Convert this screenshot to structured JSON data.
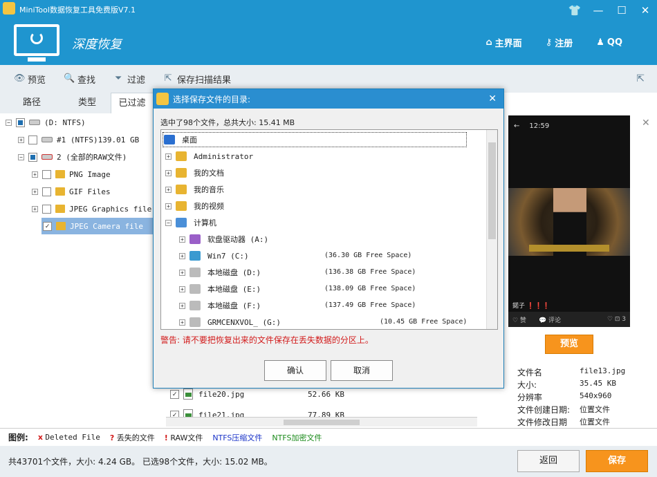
{
  "window": {
    "title": "MiniTool数据恢复工具免费版V7.1",
    "app_name": "深度恢复"
  },
  "header_nav": [
    {
      "label": "主界面",
      "icon": "home-icon"
    },
    {
      "label": "注册",
      "icon": "key-icon"
    },
    {
      "label": "QQ",
      "icon": "qq-icon"
    }
  ],
  "toolbar": {
    "preview": "预览",
    "find": "查找",
    "filter": "过滤",
    "save_scan": "保存扫描结果"
  },
  "tabs": [
    "路径",
    "类型",
    "已过滤"
  ],
  "tree": [
    {
      "label": "(D: NTFS)"
    },
    {
      "label": "#1 (NTFS)139.01 GB"
    },
    {
      "label": "2 (全部的RAW文件)"
    },
    {
      "label": "PNG Image"
    },
    {
      "label": "GIF Files"
    },
    {
      "label": "JPEG Graphics file"
    },
    {
      "label": "JPEG Camera file"
    }
  ],
  "preview_panel": {
    "phone_time": "12:59",
    "phone_caption": "鍩子 ❗❗❗",
    "phone_footer": [
      "♡ 赞",
      "💬 评论",
      "♡ ⊡ 3"
    ],
    "preview_button": "预览",
    "info": [
      {
        "k": "文件名",
        "v": "file13.jpg"
      },
      {
        "k": "大小:",
        "v": "35.45 KB"
      },
      {
        "k": "分辨率",
        "v": "540x960"
      },
      {
        "k": "文件创建日期:",
        "v": "位置文件"
      },
      {
        "k": "文件修改日期",
        "v": "位置文件"
      }
    ]
  },
  "file_list": [
    {
      "name": "file20.jpg",
      "size": "52.66 KB"
    },
    {
      "name": "file21.jpg",
      "size": "77.89 KB"
    }
  ],
  "legend": {
    "title": "图例:",
    "items": [
      {
        "symbol": "x",
        "label": "Deleted File",
        "color": "#d21b1b"
      },
      {
        "symbol": "?",
        "label": "丢失的文件",
        "color": "#d21b1b"
      },
      {
        "symbol": "!",
        "label": "RAW文件",
        "color": "#d21b1b"
      },
      {
        "symbol": "",
        "label": "NTFS压缩文件",
        "color": "#1a33c8"
      },
      {
        "symbol": "",
        "label": "NTFS加密文件",
        "color": "#1a8a1a"
      }
    ]
  },
  "status": "共43701个文件，大小: 4.24 GB。 已选98个文件，大小: 15.02 MB。",
  "buttons": {
    "back": "返回",
    "save": "保存"
  },
  "dialog": {
    "title": "选择保存文件的目录:",
    "summary": "选中了98个文件，总共大小: 15.41 MB",
    "items": [
      {
        "label": "桌面",
        "free": ""
      },
      {
        "label": "Administrator",
        "free": ""
      },
      {
        "label": "我的文档",
        "free": ""
      },
      {
        "label": "我的音乐",
        "free": ""
      },
      {
        "label": "我的视频",
        "free": ""
      },
      {
        "label": "计算机",
        "free": ""
      },
      {
        "label": "软盘驱动器 (A:)",
        "free": ""
      },
      {
        "label": "Win7 (C:)",
        "free": "(36.30 GB Free Space)"
      },
      {
        "label": "本地磁盘 (D:)",
        "free": "(136.38 GB Free Space)"
      },
      {
        "label": "本地磁盘 (E:)",
        "free": "(138.09 GB Free Space)"
      },
      {
        "label": "本地磁盘 (F:)",
        "free": "(137.49 GB Free Space)"
      },
      {
        "label": "GRMCENXVOL_ (G:)",
        "free": "(10.45 GB Free Space)"
      }
    ],
    "warning": "警告: 请不要把恢复出来的文件保存在丢失数据的分区上。",
    "ok": "确认",
    "cancel": "取消"
  }
}
